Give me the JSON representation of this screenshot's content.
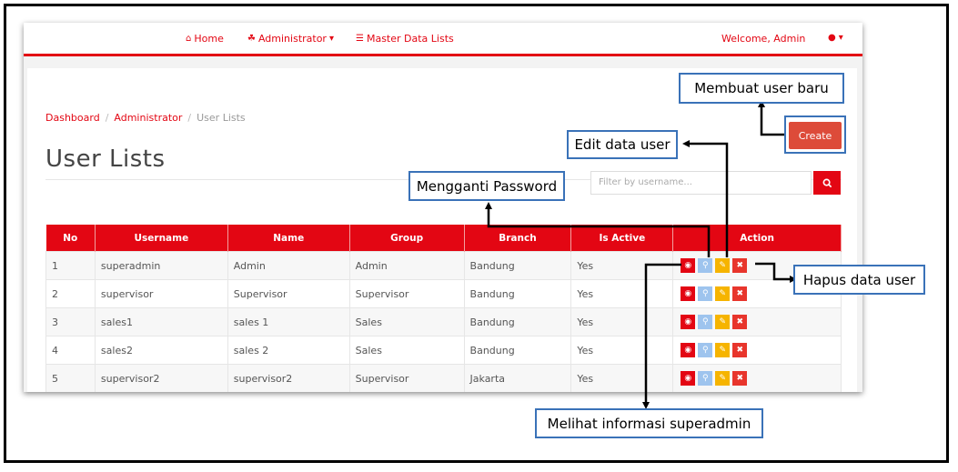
{
  "nav": {
    "home": "Home",
    "administrator": "Administrator",
    "master_data": "Master Data Lists",
    "welcome": "Welcome, Admin"
  },
  "breadcrumb": [
    "Dashboard",
    "Administrator",
    "User Lists"
  ],
  "page_title": "User Lists",
  "create_label": "Create",
  "filter_placeholder": "Filter by username...",
  "table": {
    "headers": [
      "No",
      "Username",
      "Name",
      "Group",
      "Branch",
      "Is Active",
      "Action"
    ],
    "rows": [
      [
        "1",
        "superadmin",
        "Admin",
        "Admin",
        "Bandung",
        "Yes"
      ],
      [
        "2",
        "supervisor",
        "Supervisor",
        "Supervisor",
        "Bandung",
        "Yes"
      ],
      [
        "3",
        "sales1",
        "sales 1",
        "Sales",
        "Bandung",
        "Yes"
      ],
      [
        "4",
        "sales2",
        "sales 2",
        "Sales",
        "Bandung",
        "Yes"
      ],
      [
        "5",
        "supervisor2",
        "supervisor2",
        "Supervisor",
        "Jakarta",
        "Yes"
      ]
    ]
  },
  "callouts": {
    "create": "Membuat user baru",
    "edit": "Edit data user",
    "password": "Mengganti Password",
    "delete": "Hapus data user",
    "view": "Melihat informasi superadmin"
  },
  "colors": {
    "brand_red": "#e30613",
    "create_button": "#dd4b39",
    "callout_border": "#3a72b8"
  },
  "icons": {
    "view": "eye-icon",
    "password": "key-icon",
    "edit": "edit-icon",
    "delete": "close-icon"
  }
}
